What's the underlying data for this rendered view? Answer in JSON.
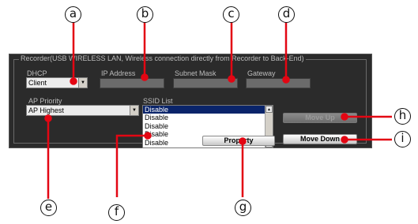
{
  "group": {
    "legend": "Recorder(USB WIRELESS LAN, Wireless connection directly from Recorder to Back-End)"
  },
  "dhcp": {
    "label": "DHCP",
    "value": "Client"
  },
  "ip_address": {
    "label": "IP Address",
    "value": ""
  },
  "subnet_mask": {
    "label": "Subnet Mask",
    "value": ""
  },
  "gateway": {
    "label": "Gateway",
    "value": ""
  },
  "ap_priority": {
    "label": "AP Priority",
    "value": "AP Highest"
  },
  "ssid_list": {
    "label": "SSID List",
    "items": [
      "Disable",
      "Disable",
      "Disable",
      "Disable",
      "Disable"
    ],
    "selected_index": 0
  },
  "buttons": {
    "move_up": {
      "label": "Move Up",
      "enabled": false
    },
    "move_down": {
      "label": "Move Down",
      "enabled": true
    },
    "property": {
      "label": "Property"
    }
  },
  "callouts": [
    "a",
    "b",
    "c",
    "d",
    "e",
    "f",
    "g",
    "h",
    "i"
  ],
  "colors": {
    "accent": "#e30613",
    "panel": "#2b2b2b",
    "selection": "#0a246a"
  }
}
